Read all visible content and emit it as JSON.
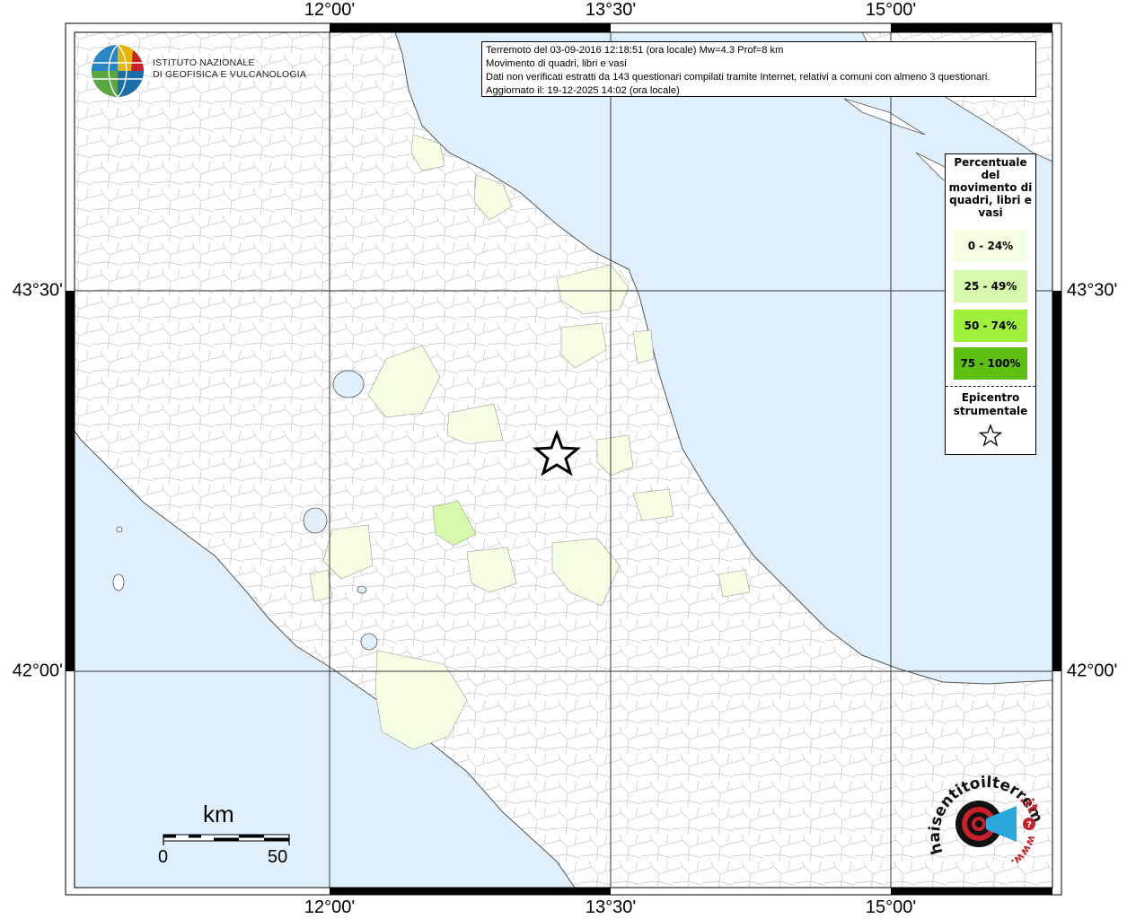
{
  "info": {
    "line1": "Terremoto del 03-09-2016 12:18:51 (ora locale) Mw=4.3 Prof=8 km",
    "line2": "Movimento di quadri, libri e vasi",
    "line3": "Dati non verificati estratti da 143 questionari compilati tramite Internet, relativi a comuni con almeno 3 questionari.",
    "line4": "Aggiornato il: 19-12-2025 14:02 (ora locale)"
  },
  "logo": {
    "line1": "ISTITUTO NAZIONALE",
    "line2": "DI GEOFISICA E VULCANOLOGIA"
  },
  "coordinates": {
    "top": [
      "12°00'",
      "13°30'",
      "15°00'"
    ],
    "bottom": [
      "12°00'",
      "13°30'",
      "15°00'"
    ],
    "left": [
      "43°30'",
      "42°00'"
    ],
    "right": [
      "43°30'",
      "42°00'"
    ]
  },
  "legend": {
    "title": "Percentuale del movimento di quadri, libri e vasi",
    "classes": [
      {
        "label": "0 - 24%",
        "color": "#f4ffe4"
      },
      {
        "label": "25 - 49%",
        "color": "#d6f7ac"
      },
      {
        "label": "50 - 74%",
        "color": "#9ef03a"
      },
      {
        "label": "75 - 100%",
        "color": "#5ec010"
      }
    ],
    "epicenter_label": "Epicentro strumentale"
  },
  "scale": {
    "unit": "km",
    "min": "0",
    "max": "50"
  },
  "watermark": {
    "text_main": "haisentitoilterremoto",
    "text_it": ".it",
    "text_www": "www."
  },
  "colors": {
    "sea": "#dff0fc",
    "land": "#ffffff",
    "grid": "#333333",
    "boundary": "#bdbdbd",
    "class_low": "#f4ffe4",
    "class_mid": "#d6f7ac"
  }
}
